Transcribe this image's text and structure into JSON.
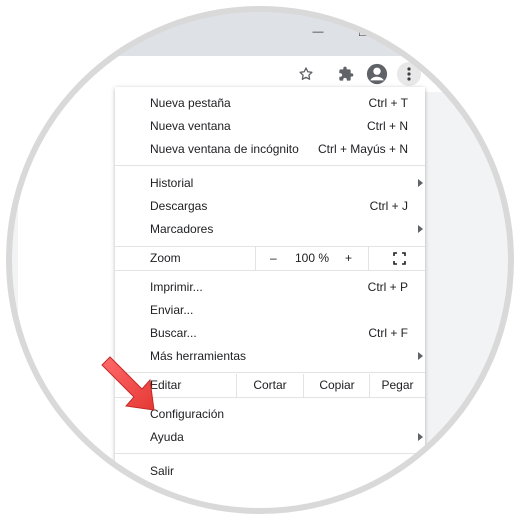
{
  "menu": {
    "new_tab": {
      "label": "Nueva pestaña",
      "shortcut": "Ctrl + T"
    },
    "new_window": {
      "label": "Nueva ventana",
      "shortcut": "Ctrl + N"
    },
    "new_incognito": {
      "label": "Nueva ventana de incógnito",
      "shortcut": "Ctrl + Mayús + N"
    },
    "history": {
      "label": "Historial"
    },
    "downloads": {
      "label": "Descargas",
      "shortcut": "Ctrl + J"
    },
    "bookmarks": {
      "label": "Marcadores"
    },
    "zoom": {
      "label": "Zoom",
      "minus": "–",
      "value": "100 %",
      "plus": "+"
    },
    "print": {
      "label": "Imprimir...",
      "shortcut": "Ctrl + P"
    },
    "cast": {
      "label": "Enviar..."
    },
    "find": {
      "label": "Buscar...",
      "shortcut": "Ctrl + F"
    },
    "more_tools": {
      "label": "Más herramientas"
    },
    "edit": {
      "label": "Editar",
      "cut": "Cortar",
      "copy": "Copiar",
      "paste": "Pegar"
    },
    "settings": {
      "label": "Configuración"
    },
    "help": {
      "label": "Ayuda"
    },
    "exit": {
      "label": "Salir"
    }
  },
  "titlebar": {
    "minimize_glyph": "—",
    "restore_glyph": "❐"
  },
  "icons": {
    "star": "star-outline-icon",
    "extensions": "puzzle-icon",
    "profile": "account-circle-icon",
    "menu": "vertical-dots-icon",
    "pointer": "red-arrow-icon"
  },
  "colors": {
    "pointer_arrow": "#ff4b4b",
    "ring": "#d9d9d9",
    "titlebar": "#dee1e6"
  }
}
